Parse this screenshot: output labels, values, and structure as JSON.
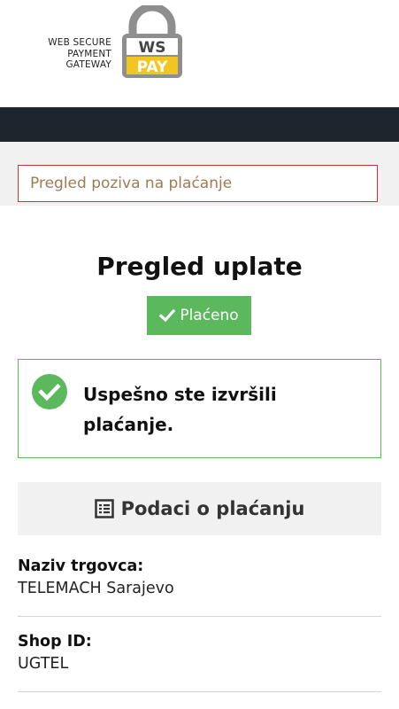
{
  "header": {
    "brand_lines": [
      "WEB SECURE",
      "PAYMENT",
      "GATEWAY"
    ],
    "logo_text_top": "WS",
    "logo_text_bottom": "PAY",
    "colors": {
      "logo_gray": "#8e8e8e",
      "logo_yellow": "#f2c521",
      "dark_bar": "#1c262c"
    }
  },
  "review_link": "Pregled poziva na plaćanje",
  "main": {
    "title": "Pregled uplate",
    "status_badge": "Plaćeno",
    "success_message": "Uspešno ste izvršili plaćanje.",
    "section_title": "Podaci o plaćanju"
  },
  "fields": [
    {
      "label": "Naziv trgovca:",
      "value": "TELEMACH Sarajevo"
    },
    {
      "label": "Shop ID:",
      "value": "UGTEL"
    }
  ],
  "icons": {
    "badge": "check-icon",
    "success": "check-circle-icon",
    "section": "list-alt-icon"
  },
  "colors": {
    "success_green": "#5cb85c",
    "alert_red": "#c9343a",
    "link_brown": "#9d7b55"
  }
}
